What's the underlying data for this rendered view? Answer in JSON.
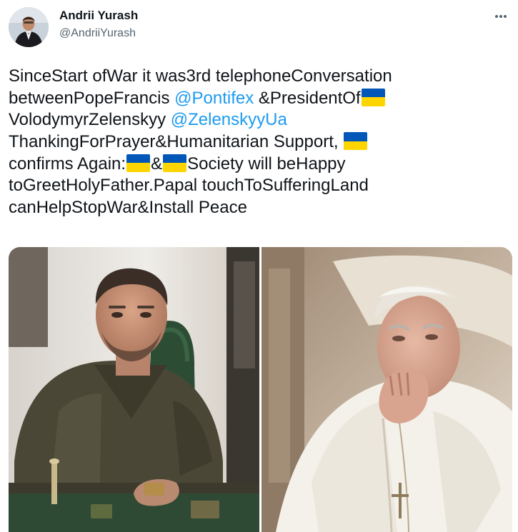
{
  "author": {
    "name": "Andrii Yurash",
    "handle": "@AndriiYurash"
  },
  "tweet": {
    "segments": {
      "l1": "SinceStart ofWar it was3rd telephoneConversation",
      "l2a": "betweenPopeFrancis ",
      "l2b": "@Pontifex",
      "l2c": " &PresidentOf",
      "l3a": "VolodymyrZelenskyy ",
      "l3b": "@ZelenskyyUa",
      "l4": "ThankingForPrayer&Humanitarian Support, ",
      "l5a": "confirms Again:",
      "l5b": "&",
      "l5c": "Society will beHappy",
      "l6": "toGreetHolyFather.Papal touchToSufferingLand",
      "l7": "canHelpStopWar&Install Peace"
    },
    "mentions": [
      "@Pontifex",
      "@ZelenskyyUa"
    ],
    "flag_colors": {
      "top": "#0057b8",
      "bottom": "#ffd500"
    }
  },
  "colors": {
    "text": "#0f1419",
    "secondary": "#536471",
    "link": "#1d9bf0"
  },
  "icons": {
    "more": "more-horizontal-icon",
    "flag": "ukraine-flag-emoji"
  }
}
